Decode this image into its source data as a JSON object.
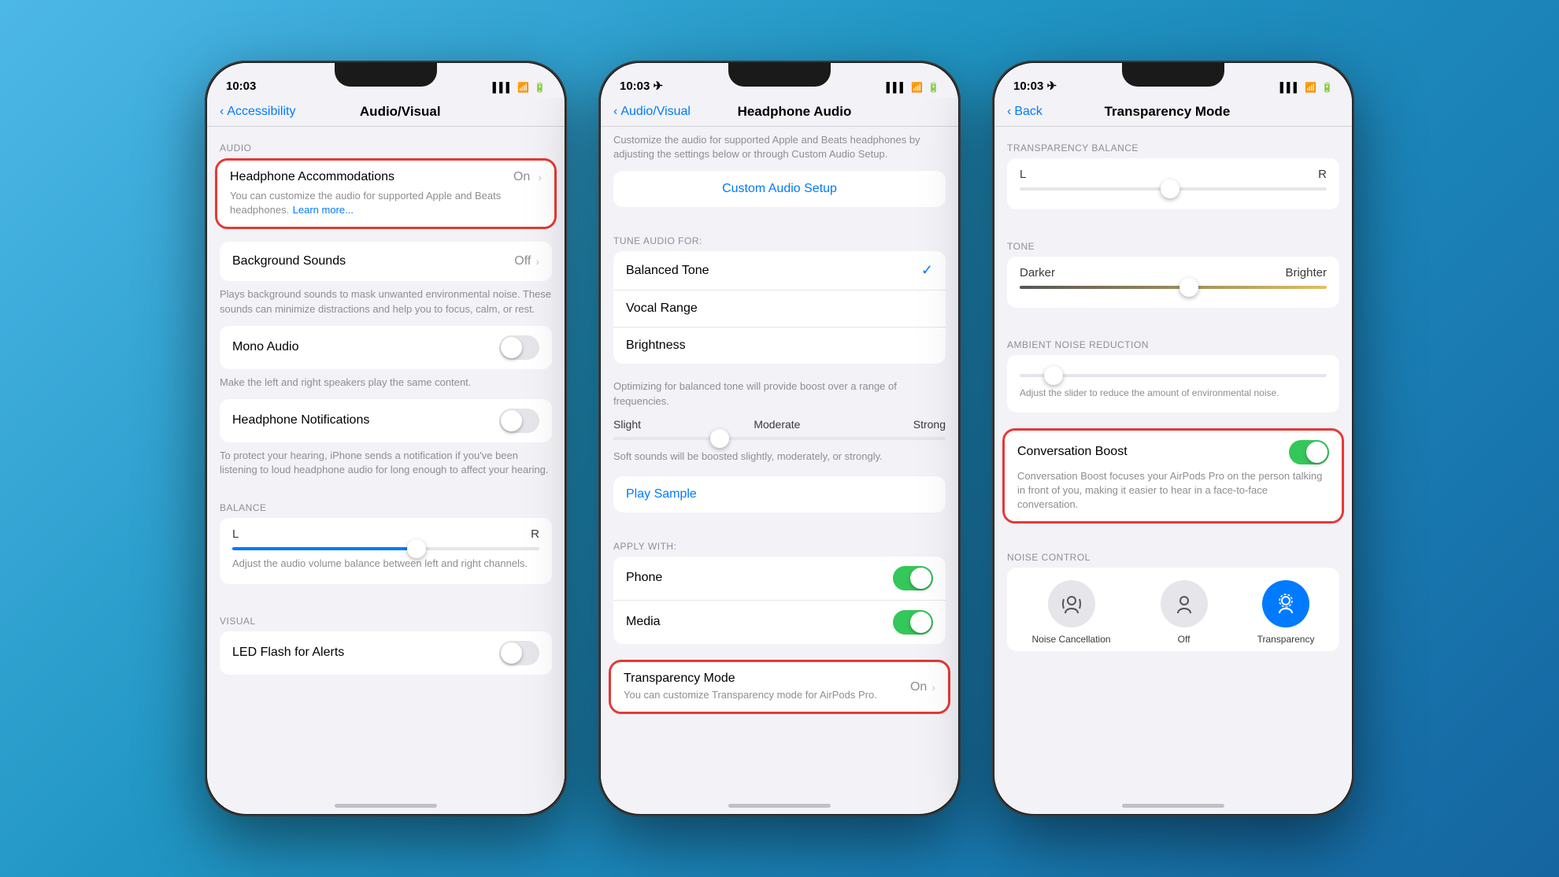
{
  "background": "#2196c4",
  "phones": [
    {
      "id": "phone1",
      "statusBar": {
        "time": "10:03",
        "signal": "▌▌▌",
        "wifi": "wifi",
        "battery": "battery"
      },
      "navBack": "Accessibility",
      "navTitle": "Audio/Visual",
      "sections": [
        {
          "header": "AUDIO",
          "items": [
            {
              "id": "headphone-accommodations",
              "title": "Headphone Accommodations",
              "value": "On",
              "subtitle": "You can customize the audio for supported Apple and Beats headphones.",
              "link": "Learn more...",
              "highlighted": true
            },
            {
              "id": "background-sounds",
              "title": "Background Sounds",
              "value": "Off",
              "chevron": true
            },
            {
              "id": "background-sounds-desc",
              "isDesc": true,
              "text": "Plays background sounds to mask unwanted environmental noise. These sounds can minimize distractions and help you to focus, calm, or rest."
            },
            {
              "id": "mono-audio",
              "title": "Mono Audio",
              "toggle": false
            },
            {
              "id": "mono-audio-desc",
              "isDesc": true,
              "text": "Make the left and right speakers play the same content."
            },
            {
              "id": "headphone-notifications",
              "title": "Headphone Notifications",
              "toggle": false
            },
            {
              "id": "headphone-notifications-desc",
              "isDesc": true,
              "text": "To protect your hearing, iPhone sends a notification if you've been listening to loud headphone audio for long enough to affect your hearing."
            }
          ]
        },
        {
          "header": "BALANCE",
          "balance": {
            "left": "L",
            "right": "R",
            "desc": "Adjust the audio volume balance between left and right channels."
          }
        },
        {
          "header": "VISUAL",
          "items": [
            {
              "id": "led-flash",
              "title": "LED Flash for Alerts",
              "toggle": false
            }
          ]
        }
      ]
    },
    {
      "id": "phone2",
      "statusBar": {
        "time": "10:03"
      },
      "navBack": "Audio/Visual",
      "navTitle": "Headphone Audio",
      "intro": "Customize the audio for supported Apple and Beats headphones by adjusting the settings below or through Custom Audio Setup.",
      "customAudioBtn": "Custom Audio Setup",
      "tuneHeader": "TUNE AUDIO FOR:",
      "tuneOptions": [
        {
          "label": "Balanced Tone",
          "selected": true
        },
        {
          "label": "Vocal Range",
          "selected": false
        },
        {
          "label": "Brightness",
          "selected": false
        }
      ],
      "tuneDesc": "Optimizing for balanced tone will provide boost over a range of frequencies.",
      "intensityLabels": [
        "Slight",
        "Moderate",
        "Strong"
      ],
      "softDesc": "Soft sounds will be boosted slightly, moderately, or strongly.",
      "playSample": "Play Sample",
      "applyWithHeader": "APPLY WITH:",
      "applyItems": [
        {
          "label": "Phone",
          "toggle": true
        },
        {
          "label": "Media",
          "toggle": true
        }
      ],
      "transparencyRow": {
        "label": "Transparency Mode",
        "value": "On",
        "highlighted": true,
        "desc": "You can customize Transparency mode for AirPods Pro."
      }
    },
    {
      "id": "phone3",
      "statusBar": {
        "time": "10:03"
      },
      "navBack": "Back",
      "navTitle": "Transparency Mode",
      "sections": [
        {
          "header": "TRANSPARENCY BALANCE",
          "balance": {
            "left": "L",
            "right": "R"
          }
        },
        {
          "header": "TONE",
          "tone": {
            "left": "Darker",
            "right": "Brighter"
          }
        },
        {
          "header": "AMBIENT NOISE REDUCTION",
          "desc": "Adjust the slider to reduce the amount of environmental noise."
        }
      ],
      "conversationBoost": {
        "label": "Conversation Boost",
        "toggle": true,
        "desc": "Conversation Boost focuses your AirPods Pro on the person talking in front of you, making it easier to hear in a face-to-face conversation.",
        "highlighted": true
      },
      "noiseControl": {
        "header": "NOISE CONTROL",
        "options": [
          {
            "label": "Noise Cancellation",
            "active": false,
            "icon": "🎧"
          },
          {
            "label": "Off",
            "active": false,
            "icon": "🎧"
          },
          {
            "label": "Transparency",
            "active": true,
            "icon": "🎧"
          }
        ]
      }
    }
  ]
}
